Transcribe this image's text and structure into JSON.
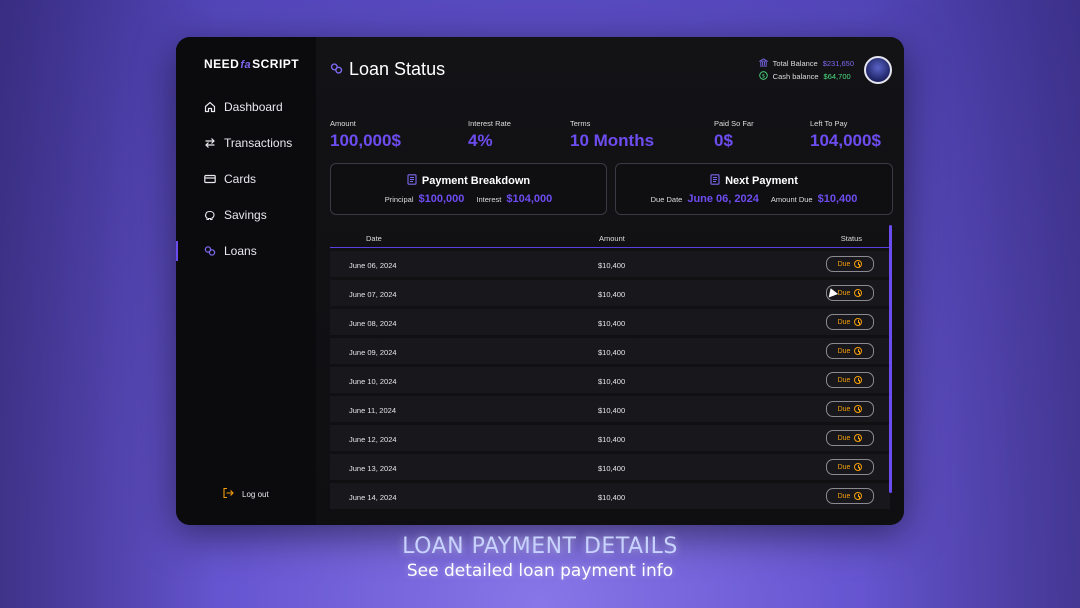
{
  "app": {
    "logo_left": "NEED",
    "logo_mid": "fa",
    "logo_right": "SCRIPT"
  },
  "sidebar": {
    "items": [
      {
        "label": "Dashboard",
        "icon": "home-icon"
      },
      {
        "label": "Transactions",
        "icon": "arrows-swap-icon"
      },
      {
        "label": "Cards",
        "icon": "credit-card-icon"
      },
      {
        "label": "Savings",
        "icon": "piggy-bank-icon"
      },
      {
        "label": "Loans",
        "icon": "loan-coins-icon",
        "active": true
      }
    ],
    "logout": "Log out"
  },
  "header": {
    "title": "Loan Status",
    "total_balance_label": "Total Balance",
    "total_balance_value": "$231,650",
    "cash_balance_label": "Cash balance",
    "cash_balance_value": "$64,700"
  },
  "stats": {
    "amount": {
      "label": "Amount",
      "value": "100,000$"
    },
    "interest": {
      "label": "Interest Rate",
      "value": "4%"
    },
    "terms": {
      "label": "Terms",
      "value": "10 Months"
    },
    "paid": {
      "label": "Paid So Far",
      "value": "0$"
    },
    "left": {
      "label": "Left To Pay",
      "value": "104,000$"
    }
  },
  "breakdown": {
    "title": "Payment Breakdown",
    "principal_label": "Principal",
    "principal_value": "$100,000",
    "interest_label": "Interest",
    "interest_value": "$104,000"
  },
  "next_payment": {
    "title": "Next Payment",
    "due_date_label": "Due Date",
    "due_date_value": "June 06, 2024",
    "amount_due_label": "Amount Due",
    "amount_due_value": "$10,400"
  },
  "table": {
    "headers": {
      "date": "Date",
      "amount": "Amount",
      "status": "Status"
    },
    "rows": [
      {
        "date": "June 06, 2024",
        "amount": "$10,400",
        "status": "Due"
      },
      {
        "date": "June 07, 2024",
        "amount": "$10,400",
        "status": "Due"
      },
      {
        "date": "June 08, 2024",
        "amount": "$10,400",
        "status": "Due"
      },
      {
        "date": "June 09, 2024",
        "amount": "$10,400",
        "status": "Due"
      },
      {
        "date": "June 10, 2024",
        "amount": "$10,400",
        "status": "Due"
      },
      {
        "date": "June 11, 2024",
        "amount": "$10,400",
        "status": "Due"
      },
      {
        "date": "June 12, 2024",
        "amount": "$10,400",
        "status": "Due"
      },
      {
        "date": "June 13, 2024",
        "amount": "$10,400",
        "status": "Due"
      },
      {
        "date": "June 14, 2024",
        "amount": "$10,400",
        "status": "Due"
      }
    ]
  },
  "caption": {
    "title": "LOAN PAYMENT DETAILS",
    "subtitle": "See detailed loan payment info"
  },
  "colors": {
    "accent": "#6d4cf0",
    "due": "#f59e0b",
    "cash": "#4ade80"
  }
}
